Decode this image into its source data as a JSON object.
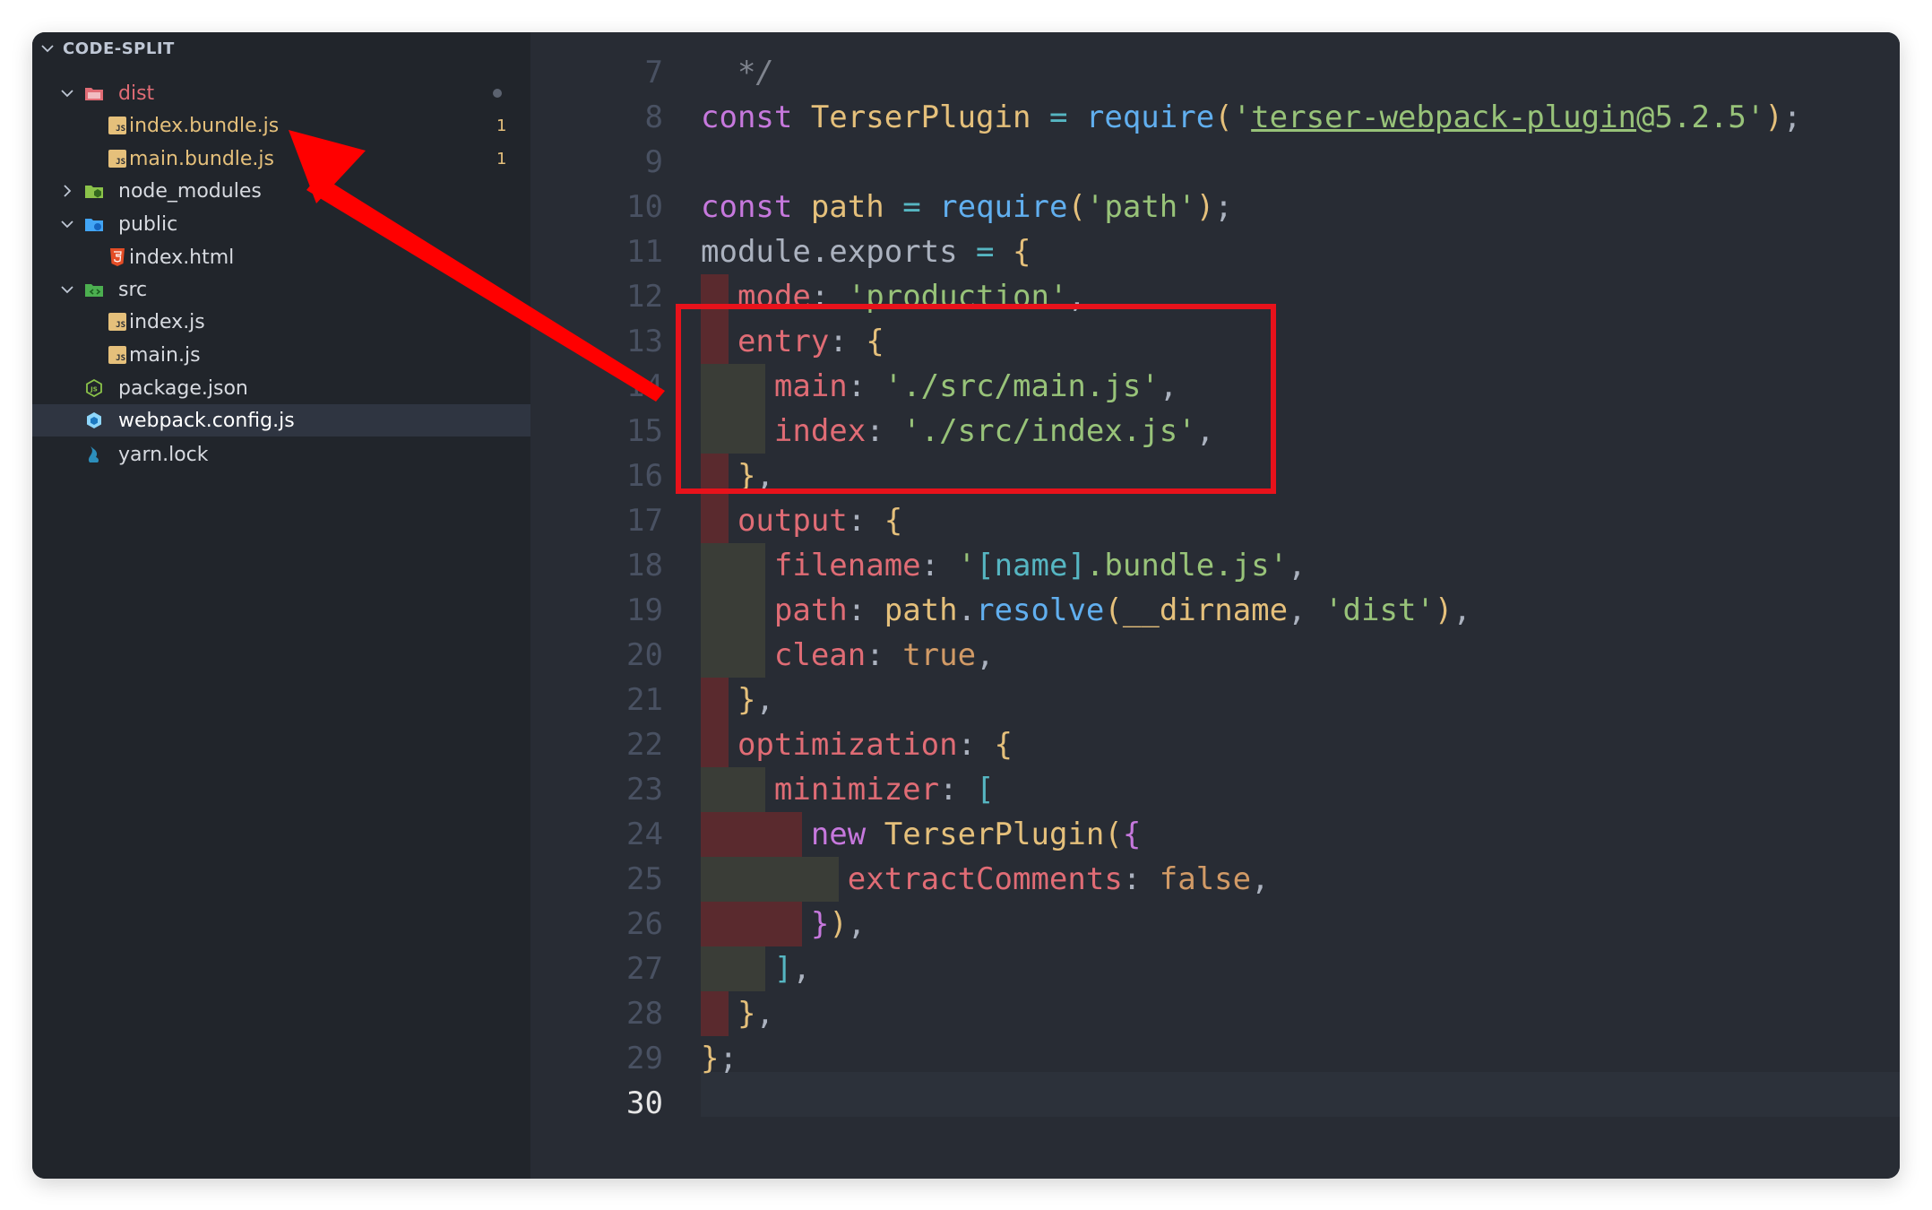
{
  "sidebar": {
    "title": "CODE-SPLIT",
    "items": [
      {
        "label": "dist",
        "badge": ""
      },
      {
        "label": "index.bundle.js",
        "badge": "1"
      },
      {
        "label": "main.bundle.js",
        "badge": "1"
      },
      {
        "label": "node_modules",
        "badge": ""
      },
      {
        "label": "public",
        "badge": ""
      },
      {
        "label": "index.html",
        "badge": ""
      },
      {
        "label": "src",
        "badge": ""
      },
      {
        "label": "index.js",
        "badge": ""
      },
      {
        "label": "main.js",
        "badge": ""
      },
      {
        "label": "package.json",
        "badge": ""
      },
      {
        "label": "webpack.config.js",
        "badge": ""
      },
      {
        "label": "yarn.lock",
        "badge": ""
      }
    ]
  },
  "editor": {
    "current_line": 30,
    "lines": [
      {
        "num": "7",
        "tokens": [
          [
            "cm",
            "  */"
          ]
        ]
      },
      {
        "num": "8",
        "tokens": [
          [
            "k",
            "const "
          ],
          [
            "c",
            "TerserPlugin"
          ],
          [
            "o",
            " = "
          ],
          [
            "f",
            "require"
          ],
          [
            "y",
            "("
          ],
          [
            "s",
            "'"
          ],
          [
            "s u",
            "terser-webpack-plugin"
          ],
          [
            "s",
            "@5.2.5'"
          ],
          [
            "y",
            ")"
          ],
          [
            "",
            "; "
          ]
        ]
      },
      {
        "num": "9",
        "tokens": []
      },
      {
        "num": "10",
        "tokens": [
          [
            "k",
            "const "
          ],
          [
            "c",
            "path"
          ],
          [
            "o",
            " = "
          ],
          [
            "f",
            "require"
          ],
          [
            "y",
            "("
          ],
          [
            "s",
            "'path'"
          ],
          [
            "y",
            ")"
          ],
          [
            "",
            ";"
          ]
        ]
      },
      {
        "num": "11",
        "tokens": [
          [
            "",
            "module.exports "
          ],
          [
            "o",
            "="
          ],
          [
            "",
            " "
          ],
          [
            "y",
            "{"
          ]
        ]
      },
      {
        "num": "12",
        "tokens": [
          [
            "",
            "  "
          ],
          [
            "p",
            "mode"
          ],
          [
            "",
            ": "
          ],
          [
            "s",
            "'production'"
          ],
          [
            "",
            ","
          ]
        ]
      },
      {
        "num": "13",
        "tokens": [
          [
            "",
            "  "
          ],
          [
            "p",
            "entry"
          ],
          [
            "",
            ": "
          ],
          [
            "y",
            "{"
          ]
        ]
      },
      {
        "num": "14",
        "tokens": [
          [
            "",
            "    "
          ],
          [
            "p",
            "main"
          ],
          [
            "",
            ": "
          ],
          [
            "s",
            "'./src/main.js'"
          ],
          [
            "",
            ","
          ]
        ]
      },
      {
        "num": "15",
        "tokens": [
          [
            "",
            "    "
          ],
          [
            "p",
            "index"
          ],
          [
            "",
            ": "
          ],
          [
            "s",
            "'./src/index.js'"
          ],
          [
            "",
            ","
          ]
        ]
      },
      {
        "num": "16",
        "tokens": [
          [
            "",
            "  "
          ],
          [
            "y",
            "}"
          ],
          [
            "",
            ","
          ]
        ]
      },
      {
        "num": "17",
        "tokens": [
          [
            "",
            "  "
          ],
          [
            "p",
            "output"
          ],
          [
            "",
            ": "
          ],
          [
            "y",
            "{"
          ]
        ]
      },
      {
        "num": "18",
        "tokens": [
          [
            "",
            "    "
          ],
          [
            "p",
            "filename"
          ],
          [
            "",
            ": "
          ],
          [
            "s",
            "'"
          ],
          [
            "b",
            "[name]"
          ],
          [
            "s",
            ".bundle.js'"
          ],
          [
            "",
            ","
          ]
        ]
      },
      {
        "num": "19",
        "tokens": [
          [
            "",
            "    "
          ],
          [
            "p",
            "path"
          ],
          [
            "",
            ": "
          ],
          [
            "c",
            "path"
          ],
          [
            "",
            "."
          ],
          [
            "f",
            "resolve"
          ],
          [
            "y",
            "("
          ],
          [
            "c",
            "__dirname"
          ],
          [
            "",
            ", "
          ],
          [
            "s",
            "'dist'"
          ],
          [
            "y",
            ")"
          ],
          [
            "",
            ","
          ]
        ]
      },
      {
        "num": "20",
        "tokens": [
          [
            "",
            "    "
          ],
          [
            "p",
            "clean"
          ],
          [
            "",
            ": "
          ],
          [
            "n",
            "true"
          ],
          [
            "",
            ","
          ]
        ]
      },
      {
        "num": "21",
        "tokens": [
          [
            "",
            "  "
          ],
          [
            "y",
            "}"
          ],
          [
            "",
            ","
          ]
        ]
      },
      {
        "num": "22",
        "tokens": [
          [
            "",
            "  "
          ],
          [
            "p",
            "optimization"
          ],
          [
            "",
            ": "
          ],
          [
            "y",
            "{"
          ]
        ]
      },
      {
        "num": "23",
        "tokens": [
          [
            "",
            "    "
          ],
          [
            "p",
            "minimizer"
          ],
          [
            "",
            ": "
          ],
          [
            "b",
            "["
          ]
        ]
      },
      {
        "num": "24",
        "tokens": [
          [
            "",
            "      "
          ],
          [
            "k",
            "new "
          ],
          [
            "c",
            "TerserPlugin"
          ],
          [
            "y",
            "("
          ],
          [
            "k",
            "{"
          ]
        ]
      },
      {
        "num": "25",
        "tokens": [
          [
            "",
            "        "
          ],
          [
            "p",
            "extractComments"
          ],
          [
            "",
            ": "
          ],
          [
            "n",
            "false"
          ],
          [
            "",
            ","
          ]
        ]
      },
      {
        "num": "26",
        "tokens": [
          [
            "",
            "      "
          ],
          [
            "k",
            "}"
          ],
          [
            "y",
            ")"
          ],
          [
            "",
            ","
          ]
        ]
      },
      {
        "num": "27",
        "tokens": [
          [
            "",
            "    "
          ],
          [
            "b",
            "]"
          ],
          [
            "",
            ","
          ]
        ]
      },
      {
        "num": "28",
        "tokens": [
          [
            "",
            "  "
          ],
          [
            "y",
            "}"
          ],
          [
            "",
            ","
          ]
        ]
      },
      {
        "num": "29",
        "tokens": [
          [
            "y",
            "}"
          ],
          [
            "",
            ";"
          ]
        ]
      },
      {
        "num": "30",
        "tokens": []
      }
    ]
  },
  "colors": {
    "highlight_box": "#e8121b",
    "arrow": "#ff0000"
  }
}
